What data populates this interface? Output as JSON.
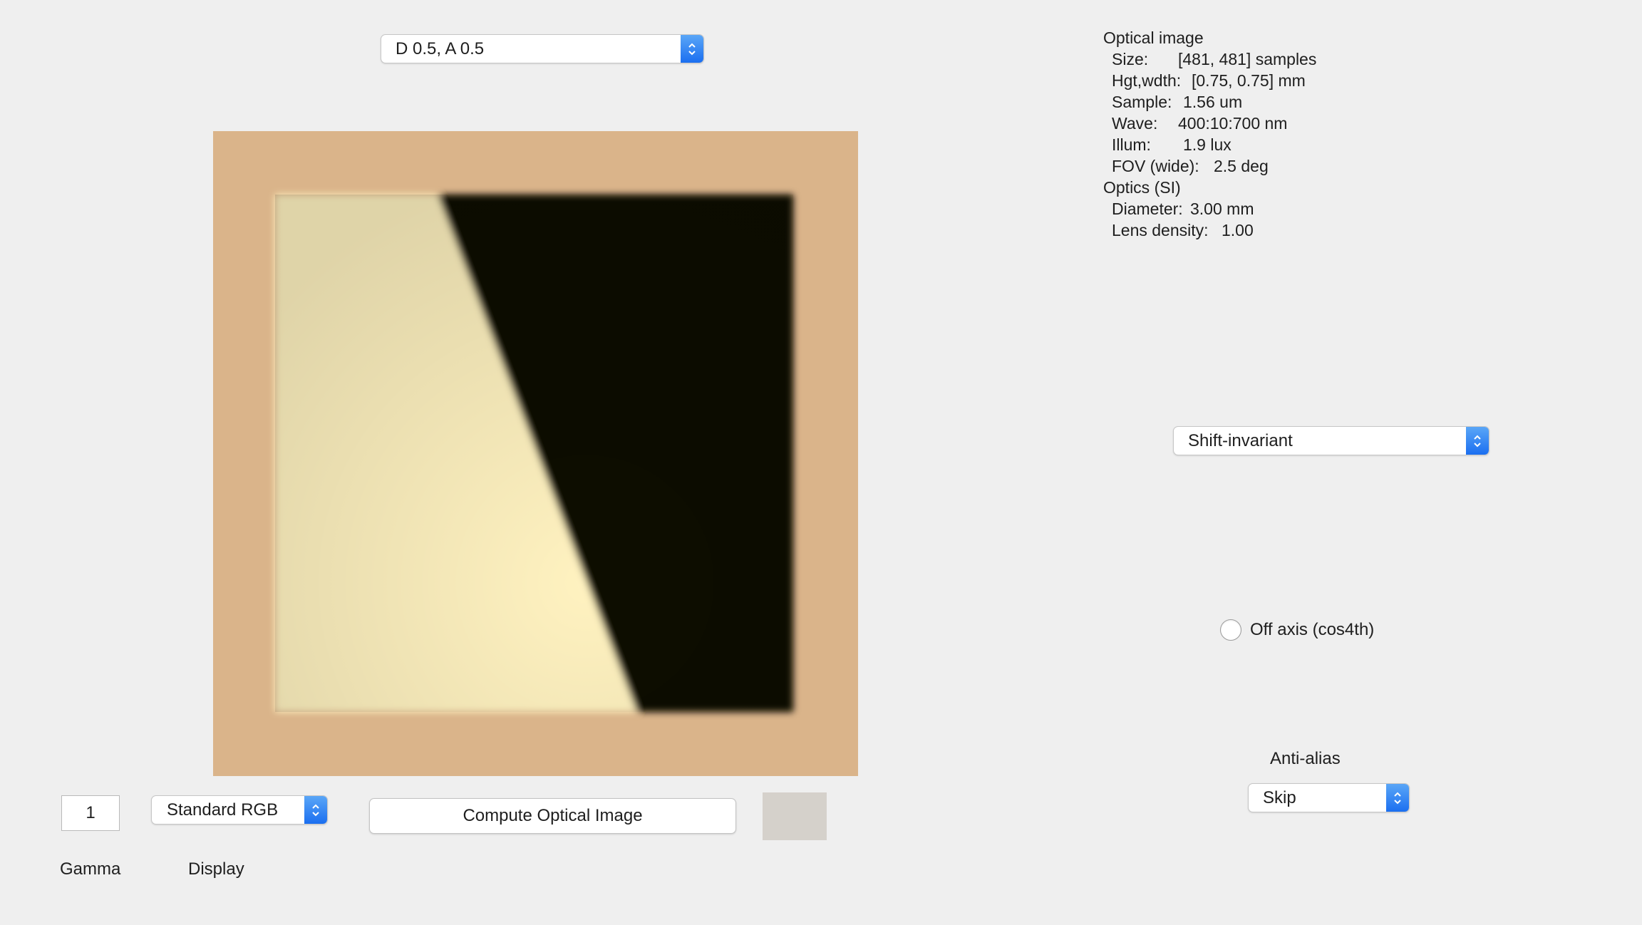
{
  "top_select": {
    "value": "D 0.5, A 0.5"
  },
  "optical_info": {
    "heading": "Optical image",
    "size_label": "Size:",
    "size_value": "[481, 481] samples",
    "hgt_label": "Hgt,wdth:",
    "hgt_value": "[0.75, 0.75] mm",
    "sample_label": "Sample:",
    "sample_value": "1.56 um",
    "wave_label": "Wave:",
    "wave_value": "400:10:700 nm",
    "illum_label": "Illum:",
    "illum_value": "1.9 lux",
    "fov_label": "FOV (wide):",
    "fov_value": "2.5 deg",
    "optics_heading": "Optics (SI)",
    "diameter_label": "Diameter:",
    "diameter_value": "3.00 mm",
    "lens_label": "Lens density:",
    "lens_value": "1.00"
  },
  "model_select": {
    "value": "Shift-invariant"
  },
  "off_axis": {
    "label": "Off axis (cos4th)",
    "checked": false
  },
  "anti_alias": {
    "label": "Anti-alias",
    "value": "Skip"
  },
  "gamma": {
    "value": "1",
    "label": "Gamma"
  },
  "display": {
    "value": "Standard RGB",
    "label": "Display"
  },
  "compute_button": {
    "label": "Compute Optical Image"
  },
  "colors": {
    "background": "#efefef",
    "image_border": "#dab48a",
    "bright_region": "#fff2c0",
    "dark_region": "#0d0703",
    "swatch": "#d5d1cb",
    "accent_blue": "#1b6ff0"
  }
}
